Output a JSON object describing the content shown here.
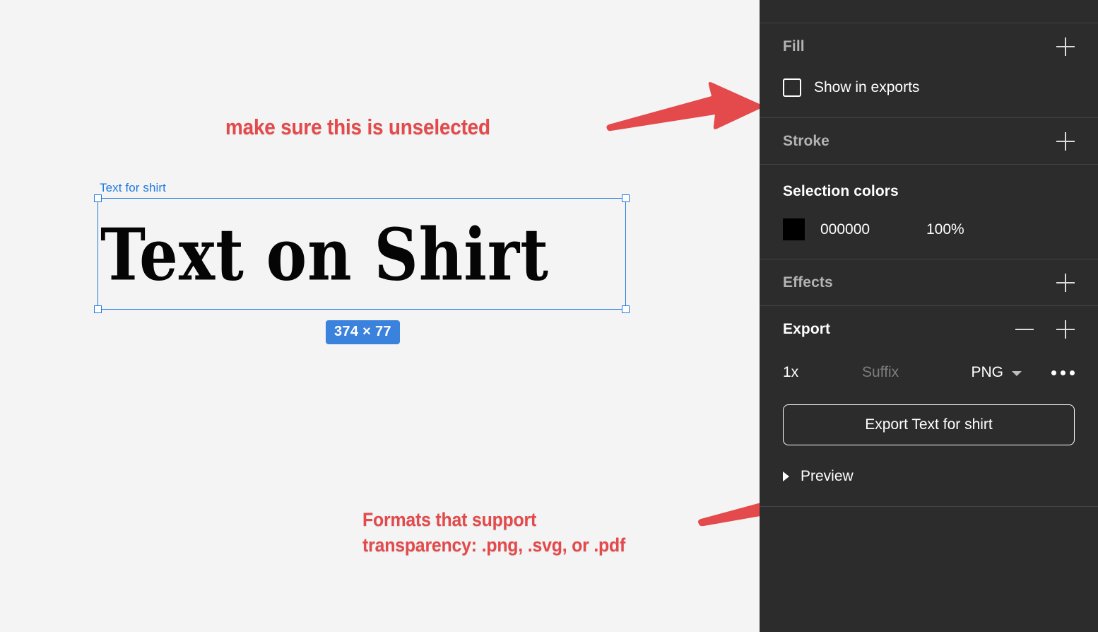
{
  "canvas": {
    "background_color": "#f4f4f4",
    "selection": {
      "layer_name": "Text for shirt",
      "text_content": "Text on Shirt",
      "size_badge": "374 × 77",
      "selection_color": "#1f78e0",
      "badge_color": "#3b82dd",
      "text_color": "#000000"
    },
    "annotations": [
      {
        "name": "annotation-unselected",
        "text": "make sure this is unselected",
        "color": "#e4494b"
      },
      {
        "name": "annotation-formats",
        "line1": "Formats that support",
        "line2": "transparency: .png, .svg, or .pdf",
        "color": "#e4494b"
      }
    ],
    "arrows": [
      {
        "name": "arrow-to-show-in-exports",
        "color": "#e4494b"
      },
      {
        "name": "arrow-to-png-format",
        "color": "#e4494b"
      }
    ]
  },
  "panel": {
    "background_color": "#2c2c2c",
    "divider_color": "#444444",
    "fill": {
      "title": "Fill",
      "add_icon": "plus-icon",
      "show_in_exports_label": "Show in exports",
      "show_in_exports_checked": false
    },
    "stroke": {
      "title": "Stroke",
      "add_icon": "plus-icon"
    },
    "selection_colors": {
      "title": "Selection colors",
      "swatch_color": "#000000",
      "hex": "000000",
      "opacity": "100%"
    },
    "effects": {
      "title": "Effects",
      "add_icon": "plus-icon"
    },
    "export": {
      "title": "Export",
      "remove_icon": "minus-icon",
      "add_icon": "plus-icon",
      "scale": "1x",
      "suffix_placeholder": "Suffix",
      "format": "PNG",
      "format_chevron_icon": "chevron-down-icon",
      "more_icon": "ellipsis-icon",
      "export_button_label": "Export Text for shirt",
      "preview_label": "Preview",
      "preview_expanded": false,
      "preview_toggle_icon": "triangle-right-icon"
    }
  }
}
